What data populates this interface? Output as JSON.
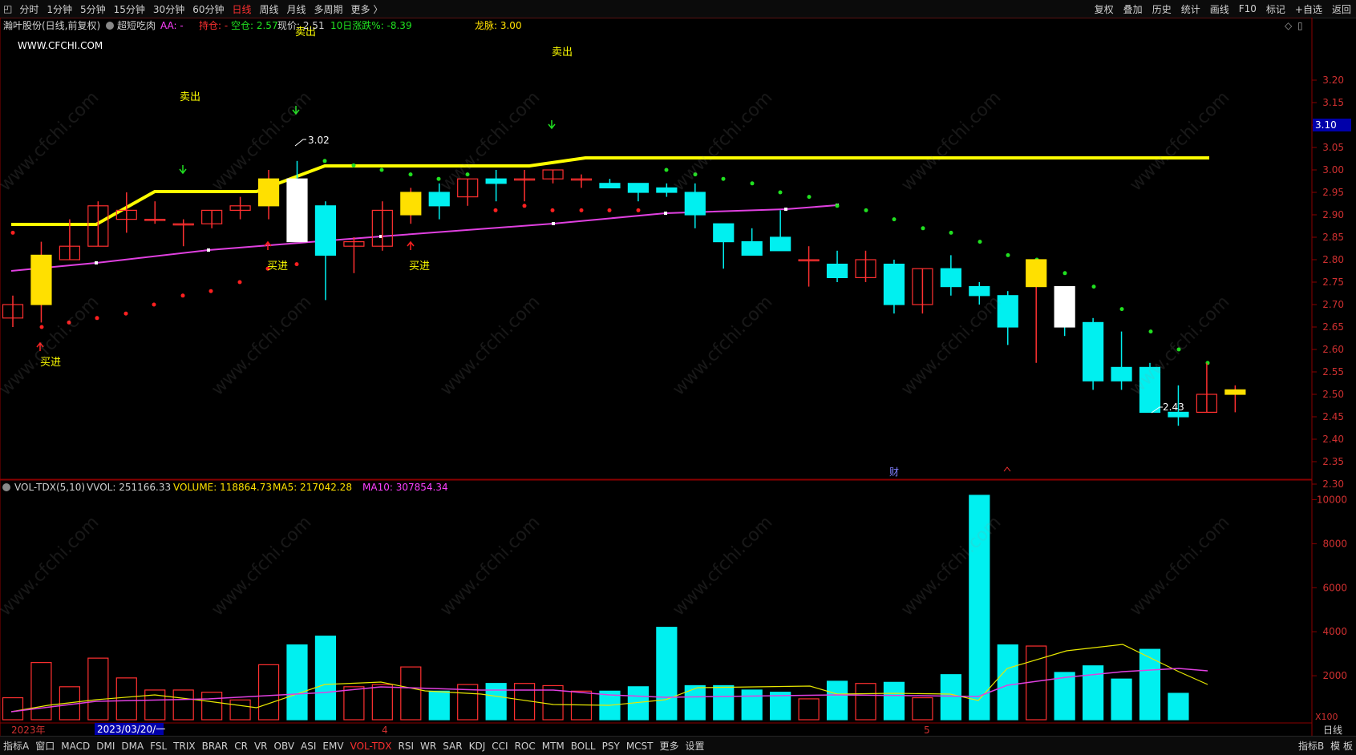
{
  "toolbar": {
    "periods": [
      "分时",
      "1分钟",
      "5分钟",
      "15分钟",
      "30分钟",
      "60分钟",
      "日线",
      "周线",
      "月线",
      "多周期",
      "更多 〉"
    ],
    "active_period": "日线",
    "tools": [
      "复权",
      "叠加",
      "历史",
      "统计",
      "画线",
      "F10",
      "标记",
      "+自选",
      "返回"
    ]
  },
  "header": {
    "stock": "瀚叶股份(日线,前复权)",
    "indicator_name": "超短吃肉",
    "aa": "AA: -",
    "duo": "持仓: -",
    "kong": "空仓: 2.57",
    "xianjia": "现价: 2.51",
    "zhangdie": "10日涨跌%: -8.39",
    "longmai": "龙脉: 3.00",
    "website": "WWW.CFCHI.COM"
  },
  "price_axis": {
    "labels": [
      "3.20",
      "3.15",
      "3.10",
      "3.05",
      "3.00",
      "2.95",
      "2.90",
      "2.85",
      "2.80",
      "2.75",
      "2.70",
      "2.65",
      "2.60",
      "2.55",
      "2.50",
      "2.45",
      "2.40",
      "2.35",
      "2.30"
    ],
    "current_marker": "3.10"
  },
  "vol_header": {
    "name": "VOL-TDX(5,10)",
    "vvol": "VVOL: 251166.33",
    "volume": "VOLUME: 118864.73",
    "ma5": "MA5: 217042.28",
    "ma10": "MA10: 307854.34"
  },
  "vol_axis": {
    "labels": [
      "10000",
      "8000",
      "6000",
      "4000",
      "2000"
    ],
    "unit": "X100"
  },
  "annotations": {
    "sell": "卖出",
    "buy": "买进",
    "high_label": "3.02",
    "low_label": "2.43",
    "cai": "财"
  },
  "date_axis": {
    "year": "2023年",
    "cursor_date": "2023/03/20/一",
    "month4": "4",
    "month5": "5",
    "right_label": "日线"
  },
  "bottom": {
    "indicators": [
      "指标A",
      "窗口",
      "MACD",
      "DMI",
      "DMA",
      "FSL",
      "TRIX",
      "BRAR",
      "CR",
      "VR",
      "OBV",
      "ASI",
      "EMV",
      "VOL-TDX",
      "RSI",
      "WR",
      "SAR",
      "KDJ",
      "CCI",
      "ROC",
      "MTM",
      "BOLL",
      "PSY",
      "MCST",
      "更多",
      "设置"
    ],
    "active_indicator": "VOL-TDX",
    "right_items": [
      "指标B",
      "模 板"
    ]
  },
  "watermark": "www.cfchi.com",
  "chart_data": {
    "type": "candlestick",
    "candles": [
      {
        "o": 2.67,
        "h": 2.72,
        "l": 2.65,
        "c": 2.7
      },
      {
        "o": 2.7,
        "h": 2.84,
        "l": 2.66,
        "c": 2.81
      },
      {
        "o": 2.8,
        "h": 2.89,
        "l": 2.8,
        "c": 2.83
      },
      {
        "o": 2.83,
        "h": 2.93,
        "l": 2.83,
        "c": 2.92
      },
      {
        "o": 2.89,
        "h": 2.95,
        "l": 2.86,
        "c": 2.91
      },
      {
        "o": 2.89,
        "h": 2.93,
        "l": 2.88,
        "c": 2.89
      },
      {
        "o": 2.88,
        "h": 2.89,
        "l": 2.83,
        "c": 2.88
      },
      {
        "o": 2.88,
        "h": 2.91,
        "l": 2.87,
        "c": 2.91
      },
      {
        "o": 2.91,
        "h": 2.94,
        "l": 2.89,
        "c": 2.92
      },
      {
        "o": 2.92,
        "h": 3.0,
        "l": 2.89,
        "c": 2.98
      },
      {
        "o": 2.98,
        "h": 3.02,
        "l": 2.84,
        "c": 2.84
      },
      {
        "o": 2.92,
        "h": 2.93,
        "l": 2.71,
        "c": 2.81
      },
      {
        "o": 2.83,
        "h": 2.85,
        "l": 2.77,
        "c": 2.84
      },
      {
        "o": 2.83,
        "h": 2.93,
        "l": 2.82,
        "c": 2.91
      },
      {
        "o": 2.9,
        "h": 2.96,
        "l": 2.88,
        "c": 2.95
      },
      {
        "o": 2.95,
        "h": 2.97,
        "l": 2.89,
        "c": 2.92
      },
      {
        "o": 2.94,
        "h": 2.98,
        "l": 2.92,
        "c": 2.98
      },
      {
        "o": 2.98,
        "h": 3.0,
        "l": 2.93,
        "c": 2.97
      },
      {
        "o": 2.98,
        "h": 3.0,
        "l": 2.93,
        "c": 2.98
      },
      {
        "o": 2.98,
        "h": 3.0,
        "l": 2.97,
        "c": 3.0
      },
      {
        "o": 2.98,
        "h": 2.99,
        "l": 2.96,
        "c": 2.98
      },
      {
        "o": 2.97,
        "h": 2.98,
        "l": 2.96,
        "c": 2.96
      },
      {
        "o": 2.97,
        "h": 2.97,
        "l": 2.93,
        "c": 2.95
      },
      {
        "o": 2.96,
        "h": 2.97,
        "l": 2.94,
        "c": 2.95
      },
      {
        "o": 2.95,
        "h": 2.97,
        "l": 2.87,
        "c": 2.9
      },
      {
        "o": 2.88,
        "h": 2.88,
        "l": 2.78,
        "c": 2.84
      },
      {
        "o": 2.84,
        "h": 2.87,
        "l": 2.81,
        "c": 2.81
      },
      {
        "o": 2.85,
        "h": 2.91,
        "l": 2.82,
        "c": 2.82
      },
      {
        "o": 2.8,
        "h": 2.83,
        "l": 2.74,
        "c": 2.8
      },
      {
        "o": 2.79,
        "h": 2.82,
        "l": 2.75,
        "c": 2.76
      },
      {
        "o": 2.76,
        "h": 2.82,
        "l": 2.75,
        "c": 2.8
      },
      {
        "o": 2.79,
        "h": 2.8,
        "l": 2.68,
        "c": 2.7
      },
      {
        "o": 2.7,
        "h": 2.78,
        "l": 2.68,
        "c": 2.78
      },
      {
        "o": 2.78,
        "h": 2.81,
        "l": 2.72,
        "c": 2.74
      },
      {
        "o": 2.74,
        "h": 2.75,
        "l": 2.7,
        "c": 2.72
      },
      {
        "o": 2.72,
        "h": 2.73,
        "l": 2.61,
        "c": 2.65
      },
      {
        "o": 2.74,
        "h": 2.8,
        "l": 2.57,
        "c": 2.8
      },
      {
        "o": 2.74,
        "h": 2.74,
        "l": 2.63,
        "c": 2.65
      },
      {
        "o": 2.66,
        "h": 2.67,
        "l": 2.51,
        "c": 2.53
      },
      {
        "o": 2.56,
        "h": 2.64,
        "l": 2.51,
        "c": 2.53
      },
      {
        "o": 2.56,
        "h": 2.57,
        "l": 2.46,
        "c": 2.46
      },
      {
        "o": 2.46,
        "h": 2.52,
        "l": 2.43,
        "c": 2.45
      },
      {
        "o": 2.46,
        "h": 2.57,
        "l": 2.46,
        "c": 2.5
      },
      {
        "o": 2.5,
        "h": 2.52,
        "l": 2.46,
        "c": 2.51
      }
    ],
    "volume": [
      1000,
      2600,
      1500,
      2800,
      1900,
      1350,
      1350,
      1250,
      900,
      2500,
      3400,
      3800,
      1500,
      1600,
      2400,
      1300,
      1600,
      1650,
      1650,
      1550,
      1300,
      1300,
      1500,
      4200,
      1550,
      1550,
      1350,
      1250,
      950,
      1750,
      1650,
      1700,
      1000,
      2050,
      10200,
      3400,
      3350,
      2150,
      2450,
      1850,
      3200,
      1200
    ],
    "ylim_price": [
      2.3,
      3.2
    ],
    "ylim_volume": [
      0,
      10000
    ]
  }
}
